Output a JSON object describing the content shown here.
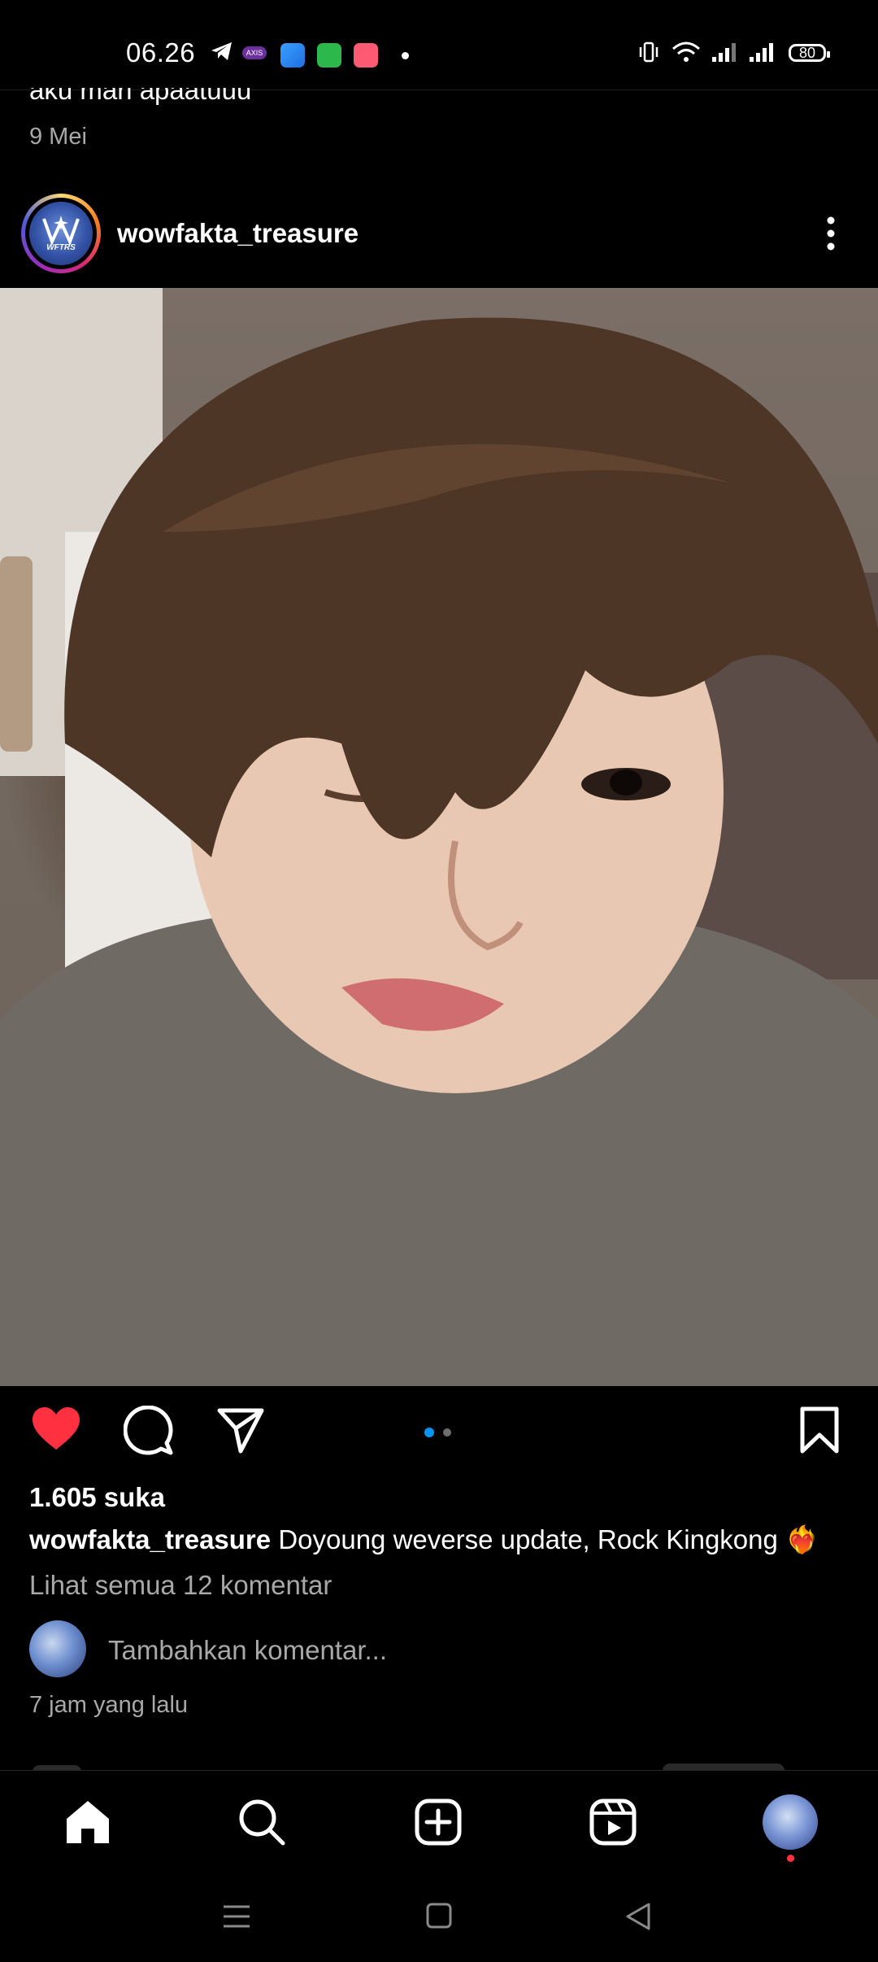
{
  "status_bar": {
    "time": "06.26",
    "battery": "80",
    "notification_icons": [
      "telegram-icon",
      "axis-icon",
      "app-icon",
      "app-icon",
      "app-icon",
      "dot-icon"
    ],
    "system_icons": [
      "vibrate-icon",
      "wifi-icon",
      "signal-icon",
      "signal-icon",
      "battery-icon"
    ]
  },
  "previous_post": {
    "caption_fragment": "aku mari apaatuuu",
    "date": "9 Mei"
  },
  "post": {
    "username": "wowfakta_treasure",
    "avatar_text": "WFTRS",
    "likes": "1.605 suka",
    "caption_user": "wowfakta_treasure",
    "caption_text": "Doyoung weverse update, Rock Kingkong",
    "caption_emoji": "❤️‍🔥",
    "view_comments": "Lihat semua 12 komentar",
    "add_comment_placeholder": "Tambahkan komentar...",
    "time_ago": "7 jam yang lalu",
    "liked": true,
    "carousel": {
      "pages": 2,
      "current": 1
    }
  },
  "bottom_nav": [
    "home-icon",
    "search-icon",
    "create-icon",
    "reels-icon",
    "profile-avatar"
  ],
  "system_nav": [
    "menu-icon",
    "home-square-icon",
    "back-icon"
  ],
  "colors": {
    "background": "#000000",
    "like_red": "#ff3040",
    "secondary_text": "#a8a8a8",
    "carousel_active": "#0095f6"
  }
}
